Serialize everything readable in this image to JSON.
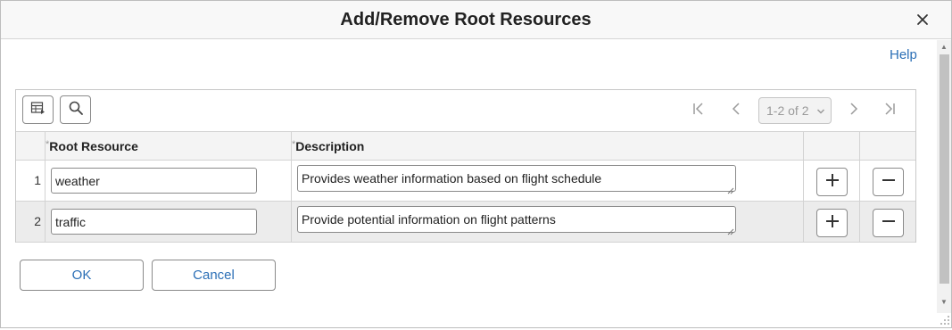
{
  "dialog": {
    "title": "Add/Remove Root Resources",
    "help_label": "Help"
  },
  "toolbar": {
    "pager_label": "1-2 of 2",
    "icons": [
      "personalize-grid-icon",
      "find-icon",
      "first-page-icon",
      "previous-page-icon",
      "next-page-icon",
      "last-page-icon"
    ]
  },
  "table": {
    "columns": [
      {
        "label": "Root Resource",
        "required": true
      },
      {
        "label": "Description",
        "required": true
      }
    ],
    "required_marker": "*",
    "rows": [
      {
        "num": "1",
        "root_resource": "weather",
        "description": "Provides weather information based on flight schedule"
      },
      {
        "num": "2",
        "root_resource": "traffic",
        "description": "Provide potential information on flight patterns"
      }
    ]
  },
  "buttons": {
    "ok": "OK",
    "cancel": "Cancel"
  },
  "colors": {
    "link": "#2b6fb6",
    "header_bg": "#f8f8f8",
    "row_alt_bg": "#ececec"
  }
}
